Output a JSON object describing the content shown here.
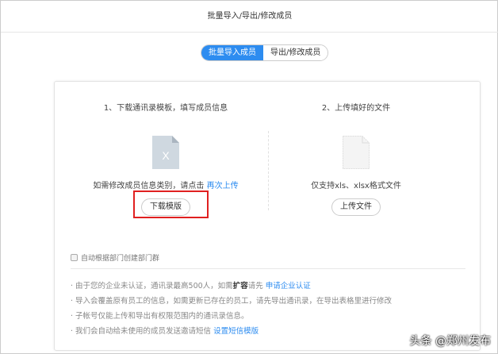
{
  "header": {
    "title": "批量导入/导出/修改成员"
  },
  "tabs": [
    {
      "label": "批量导入成员",
      "active": true
    },
    {
      "label": "导出/修改成员",
      "active": false
    }
  ],
  "left": {
    "step": "1、下载通讯录模板，填写成员信息",
    "icon_letter": "X",
    "note": "如需修改成员信息类别，请点击",
    "note_link": "再次上传",
    "button": "下载模版"
  },
  "right": {
    "step": "2、上传填好的文件",
    "note": "仅支持xls、xlsx格式文件",
    "button": "上传文件"
  },
  "checkbox": {
    "label": "自动根据部门创建部门群",
    "checked": false
  },
  "tips": {
    "t1_pre": "由于您的企业未认证，通讯录最高500人，如需",
    "t1_bold": "扩容",
    "t1_mid": "请先",
    "t1_link": "申请企业认证",
    "t2": "导入会覆盖原有员工的信息，如需更新已存在的员工，请先导出通讯录，在导出表格里进行修改",
    "t3": "子帐号仅能上传和导出有权限范围内的通讯录信息。",
    "t4_pre": "我们会自动给未使用的成员发送邀请短信",
    "t4_link": "设置短信模版"
  },
  "watermark": "头条 @郑州发布",
  "colors": {
    "accent": "#2d8cf0",
    "highlight": "#e02020"
  }
}
